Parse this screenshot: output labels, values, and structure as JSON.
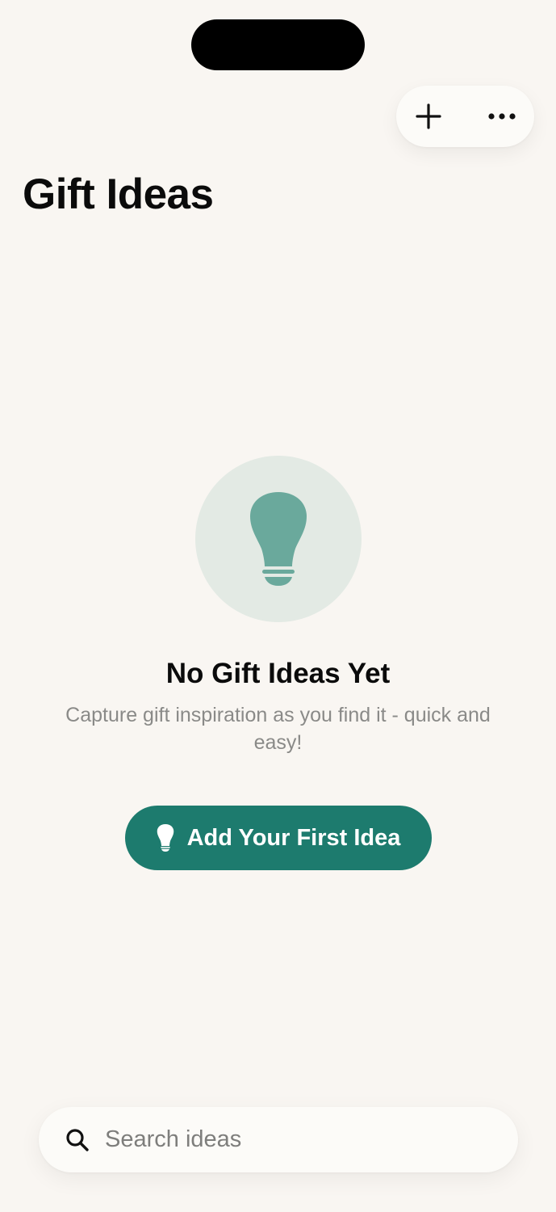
{
  "header": {
    "title": "Gift Ideas"
  },
  "toolbar": {
    "add_icon": "plus-icon",
    "more_icon": "ellipsis-icon"
  },
  "empty_state": {
    "icon": "lightbulb-icon",
    "title": "No Gift Ideas Yet",
    "subtitle": "Capture gift inspiration as you find it - quick and easy!",
    "cta_label": "Add Your First Idea",
    "cta_icon": "lightbulb-icon"
  },
  "search": {
    "icon": "search-icon",
    "placeholder": "Search ideas",
    "value": ""
  },
  "colors": {
    "background": "#F9F6F2",
    "accent": "#1D7B6E",
    "icon_tint": "#6AA99C",
    "icon_circle": "#E3EAE4"
  }
}
